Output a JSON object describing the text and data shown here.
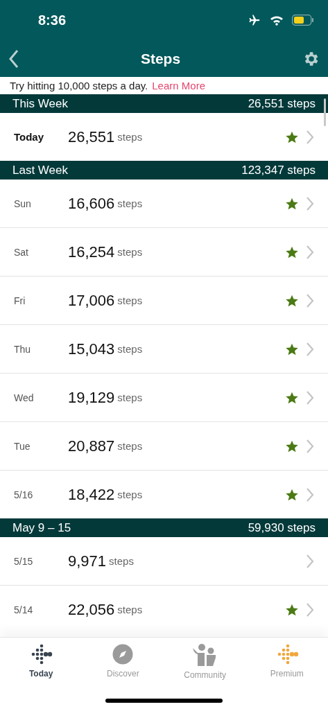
{
  "status_bar": {
    "time": "8:36"
  },
  "nav": {
    "title": "Steps"
  },
  "banner": {
    "text": "Try hitting 10,000 steps a day.",
    "link": "Learn More"
  },
  "sections": [
    {
      "title": "This Week",
      "total": "26,551 steps",
      "rows": [
        {
          "day": "Today",
          "steps": "26,551",
          "unit": "steps",
          "starred": true,
          "bold": true
        }
      ]
    },
    {
      "title": "Last Week",
      "total": "123,347 steps",
      "rows": [
        {
          "day": "Sun",
          "steps": "16,606",
          "unit": "steps",
          "starred": true,
          "bold": false
        },
        {
          "day": "Sat",
          "steps": "16,254",
          "unit": "steps",
          "starred": true,
          "bold": false
        },
        {
          "day": "Fri",
          "steps": "17,006",
          "unit": "steps",
          "starred": true,
          "bold": false
        },
        {
          "day": "Thu",
          "steps": "15,043",
          "unit": "steps",
          "starred": true,
          "bold": false
        },
        {
          "day": "Wed",
          "steps": "19,129",
          "unit": "steps",
          "starred": true,
          "bold": false
        },
        {
          "day": "Tue",
          "steps": "20,887",
          "unit": "steps",
          "starred": true,
          "bold": false
        },
        {
          "day": "5/16",
          "steps": "18,422",
          "unit": "steps",
          "starred": true,
          "bold": false
        }
      ]
    },
    {
      "title": "May 9 – 15",
      "total": "59,930 steps",
      "rows": [
        {
          "day": "5/15",
          "steps": "9,971",
          "unit": "steps",
          "starred": false,
          "bold": false
        },
        {
          "day": "5/14",
          "steps": "22,056",
          "unit": "steps",
          "starred": true,
          "bold": false
        }
      ]
    }
  ],
  "tab_bar": [
    {
      "kind": "today",
      "label": "Today",
      "selected": true
    },
    {
      "kind": "discover",
      "label": "Discover",
      "selected": false
    },
    {
      "kind": "community",
      "label": "Community",
      "selected": false
    },
    {
      "kind": "premium",
      "label": "Premium",
      "selected": false
    }
  ]
}
